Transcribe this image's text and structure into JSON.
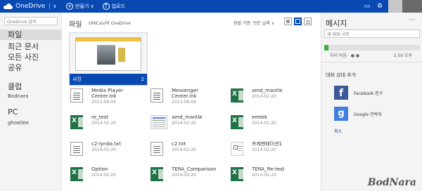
{
  "topbar": {
    "app_title": "OneDrive",
    "create_label": "만들기",
    "upload_label": "업로드",
    "colors": {
      "bar": "#094ab2"
    },
    "icons": [
      "onedrive-cloud-icon",
      "chevron-down-icon",
      "plus-icon",
      "upload-icon",
      "chat-icon",
      "gear-icon"
    ]
  },
  "sidebar": {
    "search_placeholder": "OneDrive 검색",
    "items": [
      {
        "label": "파일"
      },
      {
        "label": "최근 문서"
      },
      {
        "label": "모든 사진"
      },
      {
        "label": "공유"
      },
      {
        "label": "클럽"
      },
      {
        "label": "PC"
      }
    ],
    "club_sub": "Bodnara",
    "pc_sub": "ghostlee"
  },
  "main": {
    "title": "파일",
    "breadcrumb": "ONiCa님의 OneDrive",
    "sort_label": "정렬 기준: 만든 날짜 ∨",
    "folder": {
      "name": "사진",
      "count": "2"
    },
    "files": [
      {
        "name1": "Media Player",
        "name2": "Center.lnk",
        "date": "2013-09-04",
        "icon": "doc-icon"
      },
      {
        "name1": "Messenger",
        "name2": "Center.lnk",
        "date": "2013-09-04",
        "icon": "doc-icon"
      },
      {
        "name1": "amd_mantle",
        "name2": "",
        "date": "2014-02-20",
        "icon": "excel-icon"
      },
      {
        "name1": "re_test",
        "name2": "",
        "date": "2014-02-20",
        "icon": "excel-icon"
      },
      {
        "name1": "amd_mantle",
        "name2": "",
        "date": "2014-02-20",
        "icon": "spreadsheet-thumb-icon"
      },
      {
        "name1": "emtek",
        "name2": "",
        "date": "2014-02-20",
        "icon": "excel-icon"
      },
      {
        "name1": "c2-lynda.txt",
        "name2": "",
        "date": "2014-02-20",
        "icon": "text-file-icon"
      },
      {
        "name1": "c2.txt",
        "name2": "",
        "date": "2014-02-20",
        "icon": "text-file-icon"
      },
      {
        "name1": "프레젠테이션1",
        "name2": "",
        "date": "2014-02-20",
        "icon": "presentation-icon"
      },
      {
        "name1": "Option",
        "name2": "",
        "date": "2014-02-20",
        "icon": "excel-icon"
      },
      {
        "name1": "TERA_Comparison",
        "name2": "",
        "date": "2014-02-20",
        "icon": "excel-icon"
      },
      {
        "name1": "TERA_Re-test",
        "name2": "",
        "date": "2014-02-20",
        "icon": "excel-icon"
      }
    ]
  },
  "messages": {
    "title": "메시지",
    "more": "···",
    "new_chat_placeholder": "새 대화 시작",
    "status": "자리 비움 · ● ●",
    "time": "2:59 오후",
    "section_title": "대화 상대 추가",
    "facebook_label": "Facebook 친구",
    "google_label": "Google 연락처",
    "cancel_label": "취소"
  },
  "watermark": "BodNara"
}
